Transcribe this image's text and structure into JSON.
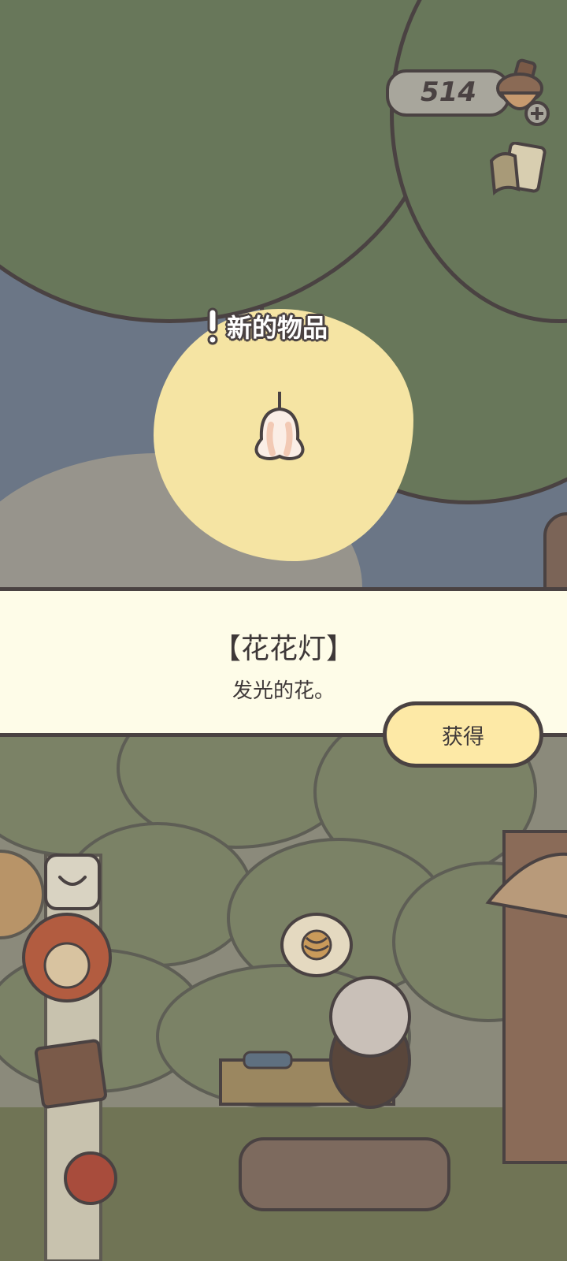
{
  "hud": {
    "currency_value": "514",
    "currency_icon": "acorn-icon",
    "add_icon": "plus-icon",
    "notebook_icon": "notebook-icon"
  },
  "popup": {
    "title": "新的物品",
    "alert_icon": "exclamation-icon",
    "item_icon": "flower-lamp-icon",
    "item_name": "【花花灯】",
    "item_description": "发光的花。",
    "obtain_button": "获得"
  },
  "scene_icons": {
    "menu_toggle": "chevron-down-icon",
    "yarn_bubble": "yarn-ball-icon",
    "character": "sheep-character"
  },
  "colors": {
    "band_bg": "#fefce8",
    "button_bg": "#fde9a6",
    "outline": "#4a4242",
    "foliage": "#68775a",
    "glow": "#f5e4a3"
  }
}
